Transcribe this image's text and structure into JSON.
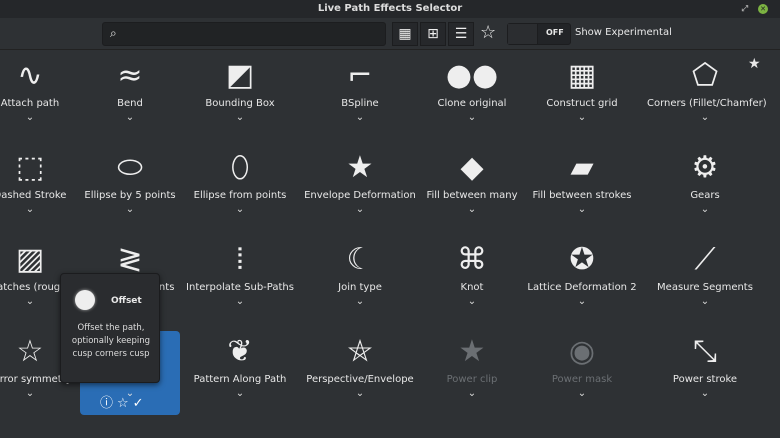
{
  "window": {
    "title": "Live Path Effects Selector"
  },
  "toolbar": {
    "search_placeholder": "",
    "toggle_state": "OFF",
    "show_experimental": "Show Experimental"
  },
  "effects": [
    {
      "label": "Attach path",
      "icon": "∿"
    },
    {
      "label": "Bend",
      "icon": "≈"
    },
    {
      "label": "Bounding Box",
      "icon": "◩"
    },
    {
      "label": "BSpline",
      "icon": "⌐"
    },
    {
      "label": "Clone original",
      "icon": "●●"
    },
    {
      "label": "Construct grid",
      "icon": "▦"
    },
    {
      "label": "Corners (Fillet/Chamfer)",
      "icon": "⬠"
    },
    {
      "label": "Dashed Stroke",
      "icon": "⬚"
    },
    {
      "label": "Ellipse by 5 points",
      "icon": "⬭"
    },
    {
      "label": "Ellipse from points",
      "icon": "⬯"
    },
    {
      "label": "Envelope Deformation",
      "icon": "★"
    },
    {
      "label": "Fill between many",
      "icon": "◆"
    },
    {
      "label": "Fill between strokes",
      "icon": "▰"
    },
    {
      "label": "Gears",
      "icon": "⚙"
    },
    {
      "label": "Hatches (rough)",
      "icon": "▨"
    },
    {
      "label": "Interpolate points",
      "icon": "≷"
    },
    {
      "label": "Interpolate Sub-Paths",
      "icon": "⦙"
    },
    {
      "label": "Join type",
      "icon": "☾"
    },
    {
      "label": "Knot",
      "icon": "⌘"
    },
    {
      "label": "Lattice Deformation 2",
      "icon": "✪"
    },
    {
      "label": "Measure Segments",
      "icon": "⟋"
    },
    {
      "label": "Mirror symmetry",
      "icon": "☆"
    },
    {
      "label": "Offset",
      "icon": ""
    },
    {
      "label": "Pattern Along Path",
      "icon": "❦"
    },
    {
      "label": "Perspective/Envelope",
      "icon": "⛤"
    },
    {
      "label": "Power clip",
      "icon": "★",
      "dim": true
    },
    {
      "label": "Power mask",
      "icon": "◉",
      "dim": true
    },
    {
      "label": "Power stroke",
      "icon": "⤡"
    }
  ],
  "tooltip": {
    "title": "Offset",
    "description": "Offset the path, optionally keeping cusp corners cusp"
  }
}
